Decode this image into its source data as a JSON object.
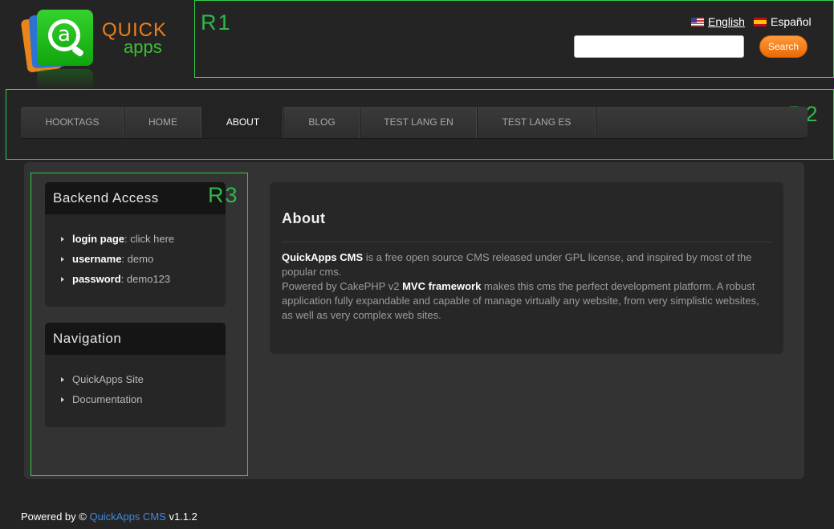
{
  "brand": {
    "logo_letter": "a",
    "name_line1": "QUICK",
    "name_line2": "apps"
  },
  "regions": {
    "r1": "R1",
    "r2": "R2",
    "r3": "R3"
  },
  "languages": [
    {
      "label": "English",
      "flag_icon": "us-flag-icon",
      "active": true
    },
    {
      "label": "Español",
      "flag_icon": "es-flag-icon",
      "active": false
    }
  ],
  "search": {
    "value": "",
    "placeholder": "",
    "button_label": "Search"
  },
  "nav": {
    "items": [
      {
        "label": "HOOKTAGS",
        "active": false
      },
      {
        "label": "HOME",
        "active": false
      },
      {
        "label": "ABOUT",
        "active": true
      },
      {
        "label": "BLOG",
        "active": false
      },
      {
        "label": "TEST LANG EN",
        "active": false
      },
      {
        "label": "TEST LANG ES",
        "active": false
      }
    ]
  },
  "sidebar": {
    "backend": {
      "title": "Backend Access",
      "items": [
        {
          "key": "login page",
          "value": "click here"
        },
        {
          "key": "username",
          "value": "demo"
        },
        {
          "key": "password",
          "value": "demo123"
        }
      ]
    },
    "navigation": {
      "title": "Navigation",
      "items": [
        "QuickApps Site",
        "Documentation"
      ]
    }
  },
  "main": {
    "title": "About",
    "p1_bold": "QuickApps CMS",
    "p1_text": " is a free open source CMS released under GPL license, and inspired by most of the popular cms.",
    "p2_pre": "Powered by CakePHP v2 ",
    "p2_bold": "MVC framework",
    "p2_text": " makes this cms the perfect development platform. A robust application fully expandable and capable of manage virtually any website, from very simplistic websites, as well as very complex web sites."
  },
  "footer": {
    "prefix": "Powered by © ",
    "link": "QuickApps CMS",
    "version": " v1.1.2"
  },
  "colors": {
    "background": "#242424",
    "accent_orange": "#f07e18",
    "accent_green": "#3ac232",
    "region_border": "#2fd04a",
    "link_blue": "#3f8ae0"
  }
}
